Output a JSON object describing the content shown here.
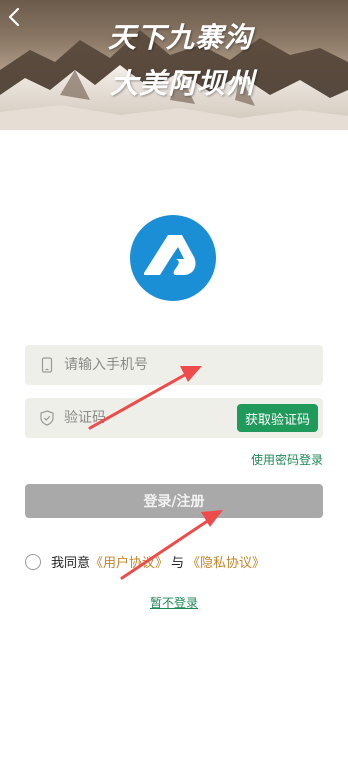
{
  "banner": {
    "line1": "天下九寨沟",
    "line2": "大美阿坝州"
  },
  "form": {
    "phone_placeholder": "请输入手机号",
    "code_placeholder": "验证码",
    "get_code_label": "获取验证码",
    "password_login_label": "使用密码登录",
    "submit_label": "登录/注册"
  },
  "agreement": {
    "prefix": "我同意",
    "user_agreement": "《用户协议》",
    "conjunction": "与",
    "privacy_agreement": "《隐私协议》"
  },
  "skip_label": "暂不登录",
  "colors": {
    "accent_green": "#1f9a5b",
    "link_gold": "#c9852a",
    "submit_disabled": "#a9a9a9",
    "logo_blue": "#1b8fd6",
    "annotation_red": "#ee4b4b"
  },
  "icons": {
    "back": "chevron-left-icon",
    "phone": "phone-icon",
    "code": "shield-check-icon"
  }
}
